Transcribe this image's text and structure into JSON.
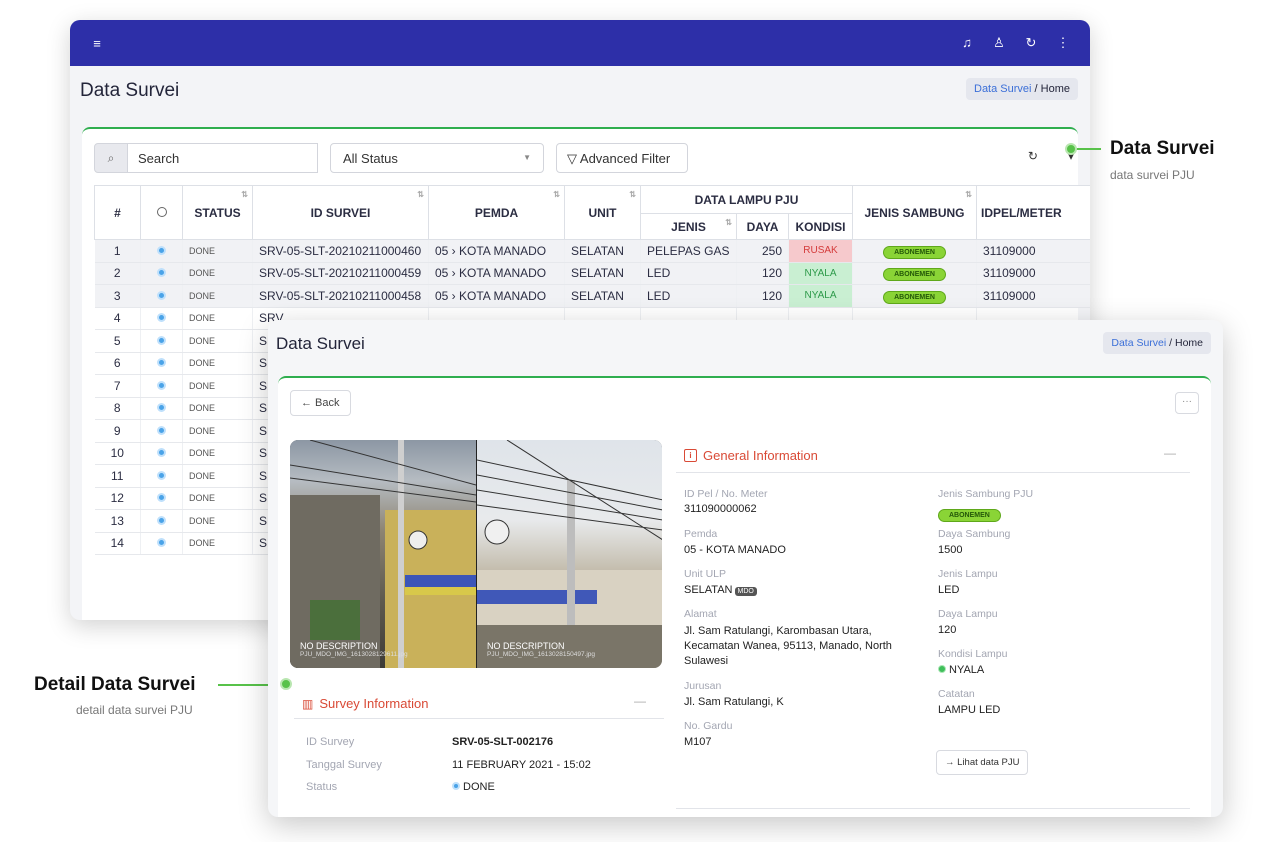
{
  "app": {
    "title": "Data Survei",
    "breadcrumb_link": "Data Survei",
    "breadcrumb_sep": " / ",
    "breadcrumb_current": "Home"
  },
  "colors": {
    "topbar": "#2d2fa8",
    "accent_green": "#2fae4f",
    "section_red": "#d94a36",
    "status_dot": "#4aa3e8"
  },
  "toolbar": {
    "search_placeholder": "Search",
    "status_select": "All Status",
    "advanced_filter": "Advanced Filter"
  },
  "table": {
    "headers": {
      "num": "#",
      "status": "STATUS",
      "id_survei": "ID SURVEI",
      "pemda": "PEMDA",
      "unit": "UNIT",
      "data_lampu": "DATA LAMPU PJU",
      "jenis": "JENIS",
      "daya": "DAYA",
      "kondisi": "KONDISI",
      "jenis_sambung": "JENIS SAMBUNG",
      "idpel": "IDPEL/METER"
    },
    "rows": [
      {
        "num": "1",
        "status": "DONE",
        "id": "SRV-05-SLT-20210211000460",
        "pemda": "05 › KOTA MANADO",
        "unit": "SELATAN",
        "jenis": "PELEPAS GAS",
        "daya": "250",
        "kondisi": "RUSAK",
        "sambung": "ABONEMEN",
        "idpel": "31109000"
      },
      {
        "num": "2",
        "status": "DONE",
        "id": "SRV-05-SLT-20210211000459",
        "pemda": "05 › KOTA MANADO",
        "unit": "SELATAN",
        "jenis": "LED",
        "daya": "120",
        "kondisi": "NYALA",
        "sambung": "ABONEMEN",
        "idpel": "31109000"
      },
      {
        "num": "3",
        "status": "DONE",
        "id": "SRV-05-SLT-20210211000458",
        "pemda": "05 › KOTA MANADO",
        "unit": "SELATAN",
        "jenis": "LED",
        "daya": "120",
        "kondisi": "NYALA",
        "sambung": "ABONEMEN",
        "idpel": "31109000"
      },
      {
        "num": "4",
        "status": "DONE",
        "id": "SRV"
      },
      {
        "num": "5",
        "status": "DONE",
        "id": "SRV"
      },
      {
        "num": "6",
        "status": "DONE",
        "id": "SRV"
      },
      {
        "num": "7",
        "status": "DONE",
        "id": "SRV"
      },
      {
        "num": "8",
        "status": "DONE",
        "id": "SRV"
      },
      {
        "num": "9",
        "status": "DONE",
        "id": "SRV"
      },
      {
        "num": "10",
        "status": "DONE",
        "id": "SRV"
      },
      {
        "num": "11",
        "status": "DONE",
        "id": "SRV"
      },
      {
        "num": "12",
        "status": "DONE",
        "id": "SRV"
      },
      {
        "num": "13",
        "status": "DONE",
        "id": "SRV"
      },
      {
        "num": "14",
        "status": "DONE",
        "id": "SRV"
      }
    ]
  },
  "detail": {
    "title": "Data Survei",
    "back": "← Back",
    "more": "···",
    "photos": [
      {
        "desc": "NO DESCRIPTION",
        "file": "PJU_MDO_IMG_1613028129611.jpg"
      },
      {
        "desc": "NO DESCRIPTION",
        "file": "PJU_MDO_IMG_1613028150497.jpg"
      }
    ],
    "general_title": "General Information",
    "survey_title": "Survey Information",
    "fields_left": [
      {
        "label": "ID Pel / No. Meter",
        "value": "311090000062"
      },
      {
        "label": "Pemda",
        "value": "05 - KOTA MANADO"
      },
      {
        "label": "Unit ULP",
        "value": "SELATAN"
      },
      {
        "label": "Alamat",
        "value": "Jl. Sam Ratulangi, Karombasan Utara, Kecamatan Wanea, 95113, Manado, North Sulawesi"
      },
      {
        "label": "Jurusan",
        "value": "Jl. Sam Ratulangi, K"
      },
      {
        "label": "No. Gardu",
        "value": "M107"
      }
    ],
    "unit_badge": "MDO",
    "fields_right": [
      {
        "label": "Jenis Sambung PJU",
        "value": "ABONEMEN"
      },
      {
        "label": "Daya Sambung",
        "value": "1500"
      },
      {
        "label": "Jenis Lampu",
        "value": "LED"
      },
      {
        "label": "Daya Lampu",
        "value": "120"
      },
      {
        "label": "Kondisi Lampu",
        "value": "NYALA"
      },
      {
        "label": "Catatan",
        "value": "LAMPU LED"
      }
    ],
    "lihat_btn": "→ Lihat data PJU",
    "survey": [
      {
        "label": "ID Survey",
        "value": "SRV-05-SLT-002176"
      },
      {
        "label": "Tanggal Survey",
        "value": "11 FEBRUARY 2021 - 15:02"
      },
      {
        "label": "Status",
        "value": "DONE"
      }
    ]
  },
  "annotations": {
    "right_title": "Data Survei",
    "right_sub": "data survei PJU",
    "left_title": "Detail Data Survei",
    "left_sub": "detail data survei PJU"
  }
}
